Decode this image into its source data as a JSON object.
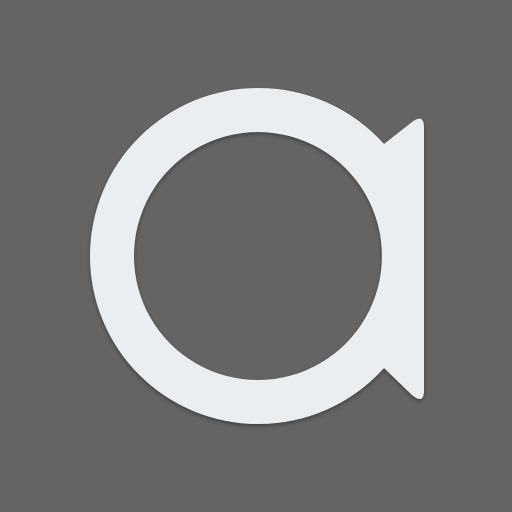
{
  "icon": {
    "name": "app-logo-a-icon",
    "background_color": "#646464",
    "glyph_color": "#EBEEF1"
  }
}
